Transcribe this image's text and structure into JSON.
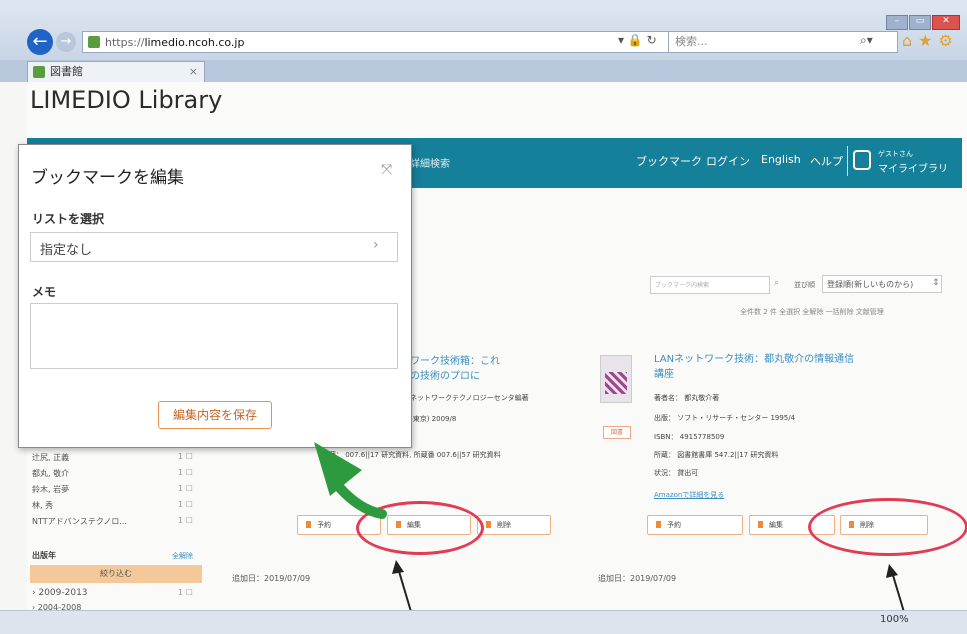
{
  "browser": {
    "url_prefix": "https://",
    "url_domain": "limedio.ncoh.co.jp",
    "url_tools": "▾ 🔒 ↻",
    "search_placeholder": "検索...",
    "tab_title": "図書館",
    "zoom": "100%"
  },
  "app": {
    "brand": "LIMEDIO Library"
  },
  "nav": {
    "left_text": "詳細検索",
    "items": [
      "ブックマーク",
      "ログイン",
      "English",
      "ヘルプ"
    ],
    "user_small": "ゲストさん",
    "user_main": "マイライブラリ"
  },
  "modal": {
    "title": "ブックマークを編集",
    "list_label": "リストを選択",
    "list_value": "指定なし",
    "memo_label": "メモ",
    "memo_value": "",
    "save_label": "編集内容を保存"
  },
  "facets": {
    "authors": [
      "辻尻, 正義",
      "都丸, 敬介",
      "鈴木, 岩夢",
      "林, 秀",
      "NTTアドバンステクノロ..."
    ],
    "pub_year_label": "出版年",
    "all_label": "全解除",
    "narrow_label": "絞り込む",
    "years": [
      "2009-2013",
      "2004-2008"
    ]
  },
  "results": {
    "search_placeholder": "ブックマーク内検索",
    "sort_label": "並び順",
    "sort_value": "登録順(新しいものから)",
    "count_row": "全件数 2 件  全選択  全解除  一括削除  文献管理",
    "item1": {
      "title_line1": "ワーク技術箱：これ",
      "title_line2": "の技術のプロに",
      "meta1": "ネットワークテクノロジーセンタ編著",
      "meta2": "(東京) 2009/8",
      "holding": "所蔵： 007.6||17 研究資料, 所蔵番 007.6||57 研究資料",
      "btn_reserve": "予約",
      "btn_edit": "編集",
      "btn_delete": "削除",
      "added": "追加日：2019/07/09"
    },
    "item2": {
      "title_line1": "LANネットワーク技術：都丸敬介の情報通信",
      "title_line2": "講座",
      "author": "著者名： 都丸敬介著",
      "publisher": "出版： ソフト・リサーチ・センター 1995/4",
      "isbn": "ISBN： 4915778509",
      "holding": "所蔵： 図書館書庫 547.2||17 研究資料",
      "status": "状況： 貸出可",
      "amazon": "Amazonで詳細を見る",
      "badge": "図書",
      "btn_reserve": "予約",
      "btn_edit": "編集",
      "btn_delete": "削除",
      "added": "追加日：2019/07/09"
    }
  },
  "colors": {
    "nav_bg": "#15809a",
    "accent_orange": "#e8924a",
    "annotation_red": "#e23b55",
    "annotation_green": "#2e9a3f"
  }
}
